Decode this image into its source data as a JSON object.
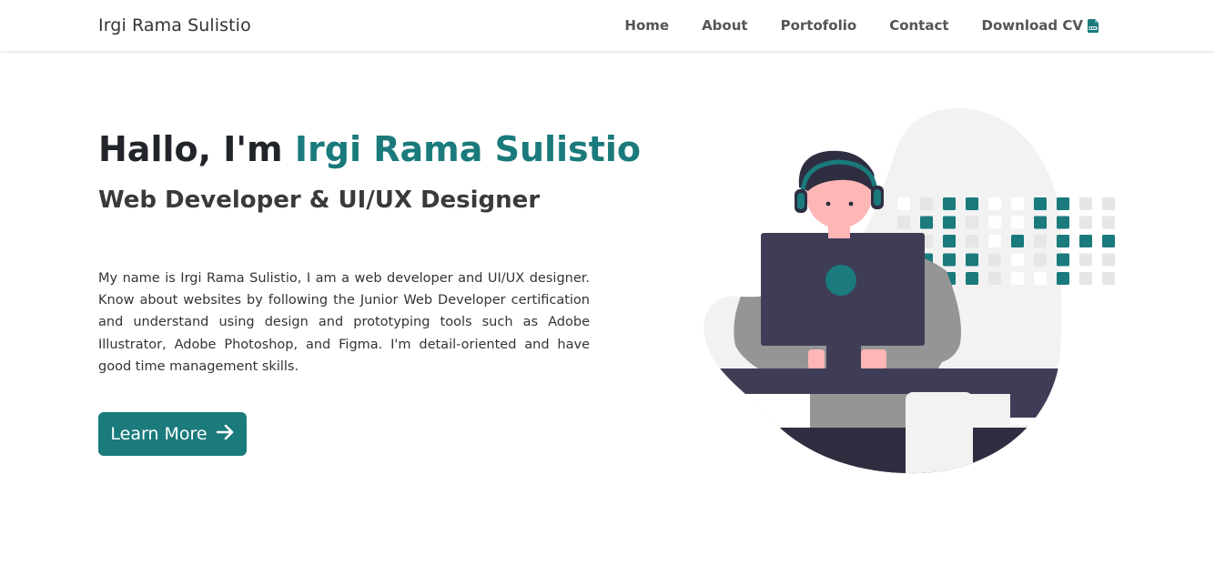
{
  "navbar": {
    "brand": "Irgi Rama Sulistio",
    "links": [
      "Home",
      "About",
      "Portofolio",
      "Contact",
      "Download CV"
    ]
  },
  "hero": {
    "greeting": "Hallo, I'm ",
    "name": "Irgi Rama Sulistio",
    "subtitle": "Web Developer & UI/UX Designer",
    "description": "My name is Irgi Rama Sulistio, I am a web developer and UI/UX designer. Know about websites by following the Junior Web Developer certification and understand using design and prototyping tools such as Adobe Illustrator, Adobe Photoshop, and Figma. I'm detail-oriented and have good time management skills.",
    "button_label": "Learn More"
  },
  "icons": {
    "download": "pdf-file-icon",
    "button": "arrow-right-icon"
  },
  "colors": {
    "accent": "#1a7a7c",
    "dark": "#3f3d56",
    "skin": "#ffb6b6",
    "shirt": "#959595",
    "blob": "#f2f2f2"
  }
}
